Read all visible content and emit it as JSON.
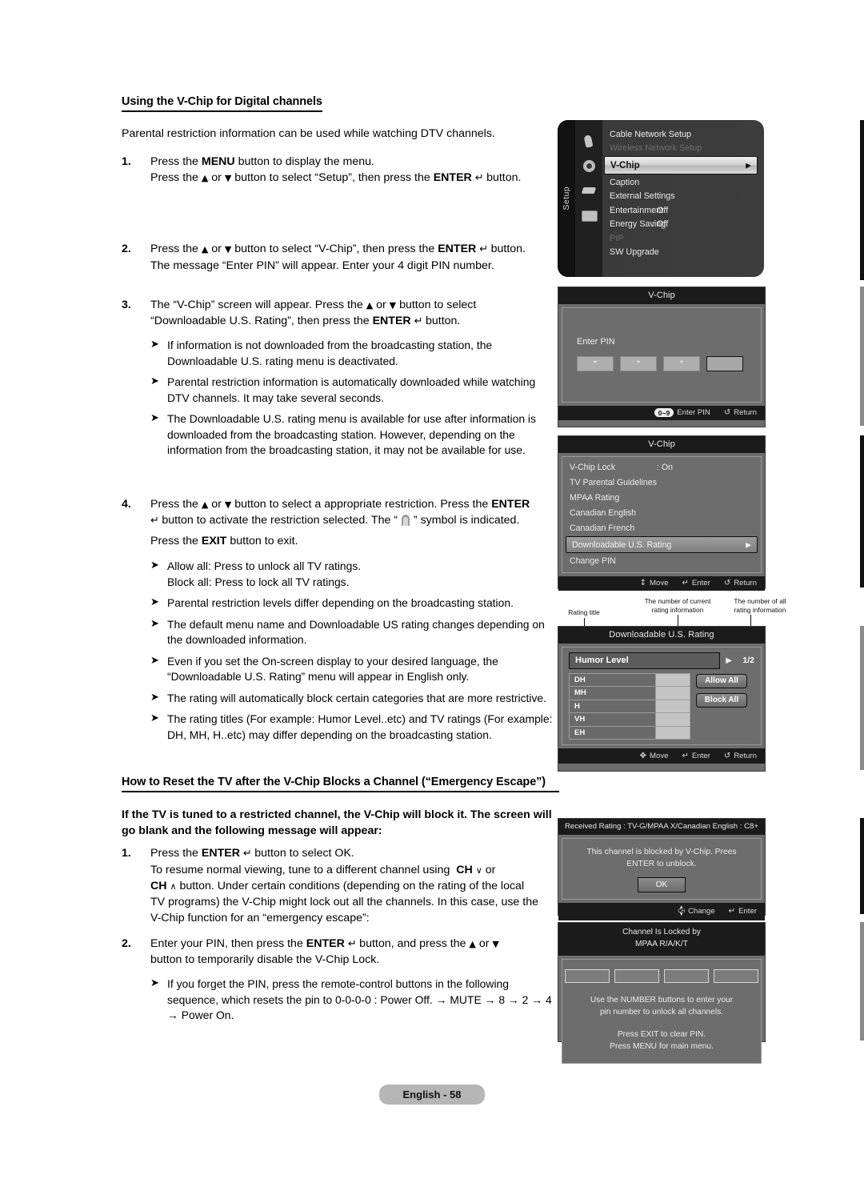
{
  "doc": {
    "section_title": "Using the V-Chip for Digital channels",
    "intro": "Parental restriction information can be used while watching DTV channels.",
    "steps": [
      {
        "num": "1.",
        "lines": [
          "Press the MENU button to display the menu.",
          "Press the ▲ or ▼ button to select “Setup”, then press the ENTER ↵ button."
        ]
      },
      {
        "num": "2.",
        "lines": [
          "Press the ▲ or ▼ button to select “V-Chip”, then press the ENTER ↵ button.",
          "The message “Enter PIN” will appear. Enter your 4 digit PIN number."
        ]
      },
      {
        "num": "3.",
        "lines": [
          "The “V-Chip” screen will appear. Press the ▲ or ▼ button to select “Downloadable U.S. Rating”, then press the ENTER ↵ button."
        ],
        "bullets": [
          "If information is not downloaded from the broadcasting station, the Downloadable U.S. rating menu is deactivated.",
          "Parental restriction information is automatically downloaded while watching DTV channels. It may take several seconds.",
          "The Downloadable U.S. rating menu is available for use after information is downloaded from the broadcasting station. However, depending on the information from the broadcasting station, it may not be available for use."
        ]
      },
      {
        "num": "4.",
        "lines": [
          "Press the ▲ or ▼ button to select a appropriate restriction. Press the ENTER ↵ button to activate the restriction selected. The “ ” symbol is indicated.",
          "Press the EXIT button to exit."
        ],
        "bullets": [
          "Allow all: Press to unlock all TV ratings.\nBlock all: Press to lock all TV ratings.",
          "Parental restriction levels differ depending on the broadcasting station.",
          "The default menu name and Downloadable US rating changes depending on the downloaded information.",
          "Even if you set the On-screen display to your desired language, the “Downloadable U.S. Rating” menu will appear in English only.",
          "The rating will automatically block certain categories that are more restrictive.",
          "The rating titles (For example: Humor Level..etc) and TV ratings (For example: DH, MH, H..etc) may differ depending on the broadcasting station."
        ]
      }
    ],
    "section2_title": "How to Reset the TV after the V-Chip Blocks a Channel (“Emergency Escape”)",
    "section2_lead": "If the TV is tuned to a restricted channel, the V-Chip will block it. The screen will go blank and the following message will appear:",
    "steps2": [
      {
        "num": "1.",
        "lines": [
          "Press the ENTER ↵ button to select OK.",
          "To resume normal viewing, tune to a different channel using CH ∨ or CH ∧ button. Under certain conditions (depending on the rating of the local TV programs) the V-Chip might lock out all the channels. In this case, use the V-Chip function for an “emergency escape”:"
        ]
      },
      {
        "num": "2.",
        "lines": [
          "Enter your PIN, then press the ENTER ↵ button, and press the ▲ or ▼ button to temporarily disable the V-Chip Lock."
        ],
        "bullets": [
          "If you forget the PIN, press the remote-control buttons in the following sequence, which resets the pin to 0-0-0-0 : Power Off. → MUTE → 8 → 2 → 4 → Power On."
        ]
      }
    ],
    "footer": "English - 58"
  },
  "setup_menu": {
    "tab_label": "Setup",
    "icons": [
      "hand-icon",
      "gear-icon",
      "plug-icon",
      "tv-icon"
    ],
    "items": [
      {
        "label": "Cable Network Setup",
        "value": "",
        "state": "normal"
      },
      {
        "label": "Wireless Network Setup",
        "value": "",
        "state": "disabled"
      },
      {
        "label": "V-Chip",
        "value": "",
        "state": "selected"
      },
      {
        "label": "Caption",
        "value": "",
        "state": "normal"
      },
      {
        "label": "External Settings",
        "value": "",
        "state": "normal"
      },
      {
        "label": "Entertainment",
        "value": ": Off",
        "state": "normal"
      },
      {
        "label": "Energy Saving",
        "value": ": Off",
        "state": "normal"
      },
      {
        "label": "PIP",
        "value": "",
        "state": "disabled"
      },
      {
        "label": "SW Upgrade",
        "value": "",
        "state": "normal"
      }
    ]
  },
  "pin_screen": {
    "title": "V-Chip",
    "label": "Enter PIN",
    "boxes": [
      "*",
      "*",
      "*",
      ""
    ],
    "footer": {
      "keys": "0~9",
      "enter_pin": "Enter PIN",
      "return": "Return"
    }
  },
  "vchip_screen": {
    "title": "V-Chip",
    "items": [
      {
        "label": "V-Chip Lock",
        "value": ": On",
        "state": "normal"
      },
      {
        "label": "TV Parental Guidelines",
        "value": "",
        "state": "normal"
      },
      {
        "label": "MPAA Rating",
        "value": "",
        "state": "normal"
      },
      {
        "label": "Canadian English",
        "value": "",
        "state": "normal"
      },
      {
        "label": "Canadian French",
        "value": "",
        "state": "normal"
      },
      {
        "label": "Downloadable U.S. Rating",
        "value": "",
        "state": "selected"
      },
      {
        "label": "Change PIN",
        "value": "",
        "state": "normal"
      }
    ],
    "footer": {
      "move": "Move",
      "enter": "Enter",
      "return": "Return"
    }
  },
  "callouts": {
    "rating_title": "Rating title",
    "current_count": "The number of current\nrating information",
    "all_count": "The number of all\nrating information"
  },
  "downloadable_screen": {
    "title": "Downloadable U.S. Rating",
    "rating_title": "Humor Level",
    "count": "1/2",
    "ratings": [
      "DH",
      "MH",
      "H",
      "VH",
      "EH"
    ],
    "allow_all": "Allow All",
    "block_all": "Block All",
    "footer": {
      "move": "Move",
      "enter": "Enter",
      "return": "Return"
    }
  },
  "blocked_screen": {
    "title": "Received Rating : TV-G/MPAA X/Canadian English : C8+",
    "message": "This channel is blocked by V-Chip. Prees ENTER to unblock.",
    "ok": "OK",
    "footer": {
      "change": "Change",
      "enter": "Enter",
      "ch_label": "CH"
    }
  },
  "locked_screen": {
    "title_line1": "Channel Is Locked by",
    "title_line2": "MPAA R/A/K/T",
    "message1": "Use the NUMBER buttons to enter your\npin number to unlock all channels.",
    "message2": "Press EXIT to clear PIN.\nPress MENU for main menu."
  },
  "colors": {
    "osd_panel": "#6d6d6d",
    "osd_titlebar": "#1b1b1b",
    "footer_badge": "#b5b5b5",
    "selected_row": "#cfcfcf"
  }
}
